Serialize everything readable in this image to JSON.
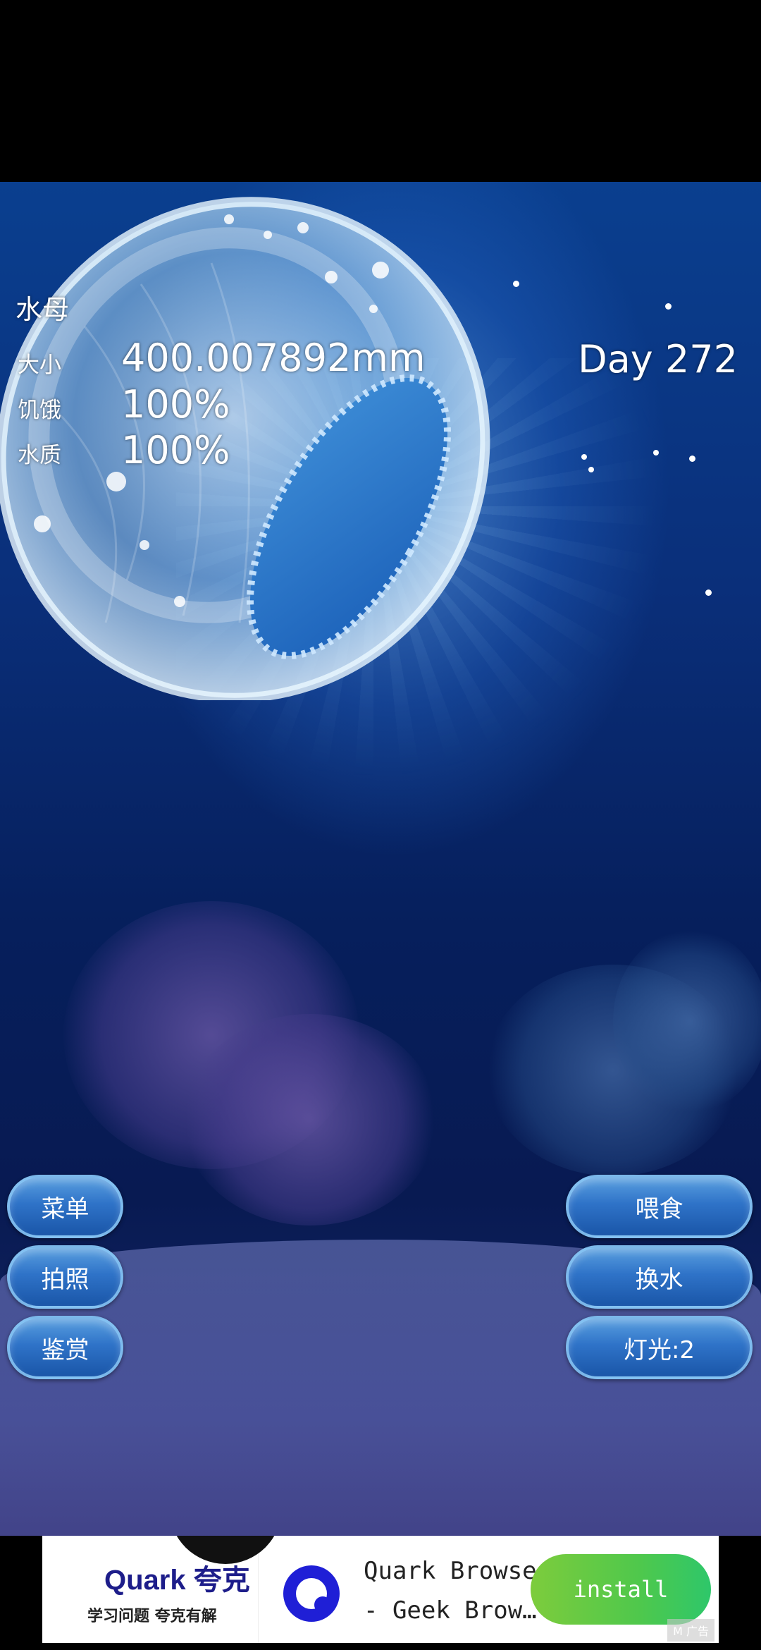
{
  "hud": {
    "name": "水母",
    "stats": [
      {
        "label": "大小",
        "value": "400.007892mm"
      },
      {
        "label": "饥饿",
        "value": "100%"
      },
      {
        "label": "水质",
        "value": "100%"
      }
    ],
    "day": "Day 272"
  },
  "buttons": {
    "menu": "菜单",
    "photo": "拍照",
    "appreciate": "鉴赏",
    "feed": "喂食",
    "change_water": "换水",
    "light": "灯光:2"
  },
  "ad": {
    "brand_name": "Quark 夸克",
    "brand_tagline": "学习问题 夸克有解",
    "line1": "Quark Browser",
    "line2": "- Geek Brow…",
    "install_label": "install",
    "badge": "M 广告"
  },
  "colors": {
    "button_fill": "#2f73c8",
    "install_green": "#4fc84c"
  }
}
